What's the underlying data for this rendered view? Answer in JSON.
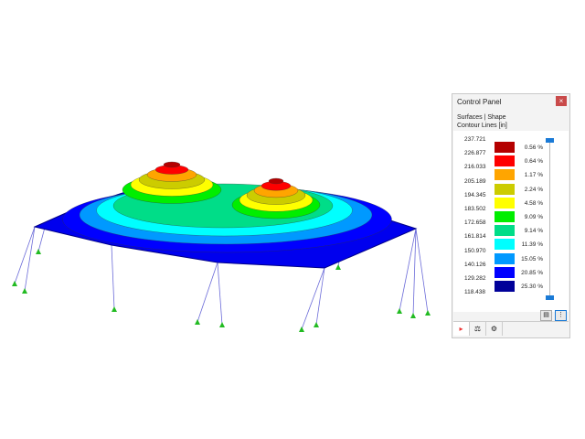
{
  "panel": {
    "title": "Control Panel",
    "close": "×",
    "line1": "Surfaces | Shape",
    "line2": "Contour Lines [in]"
  },
  "legend": {
    "values": [
      "237.721",
      "226.877",
      "216.033",
      "205.189",
      "194.345",
      "183.502",
      "172.658",
      "161.814",
      "150.970",
      "140.126",
      "129.282",
      "118.438"
    ],
    "percents": [
      "0.56 %",
      "0.64 %",
      "1.17 %",
      "2.24 %",
      "4.58 %",
      "9.09 %",
      "9.14 %",
      "11.39 %",
      "15.05 %",
      "20.85 %",
      "25.30 %"
    ],
    "colors": [
      "#b40000",
      "#ff0000",
      "#ffa500",
      "#cccc00",
      "#ffff00",
      "#00ee00",
      "#00dd88",
      "#00ffff",
      "#0099ff",
      "#0000ff",
      "#000099"
    ]
  },
  "icons": {
    "export": "export-icon",
    "legend_toggle": "legend-icon",
    "tab1": "color-scale-icon",
    "tab2": "display-icon",
    "tab3": "settings-icon"
  }
}
